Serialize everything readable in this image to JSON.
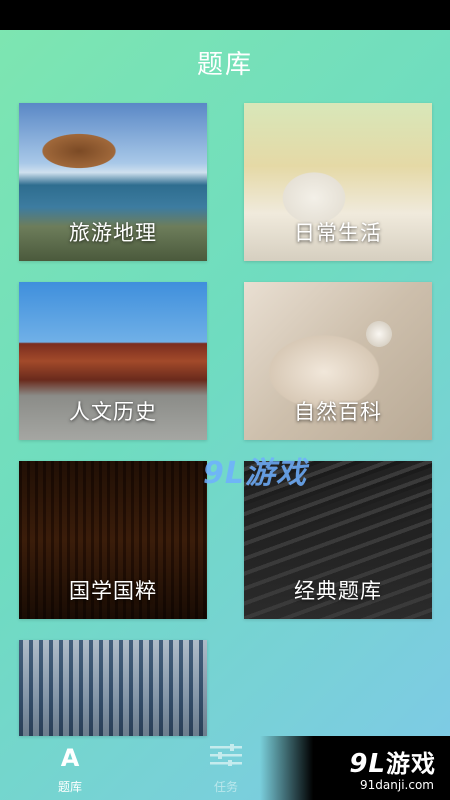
{
  "header": {
    "title": "题库"
  },
  "categories": [
    {
      "label": "旅游地理",
      "image": "travel-geography-photo"
    },
    {
      "label": "日常生活",
      "image": "daily-life-photo"
    },
    {
      "label": "人文历史",
      "image": "humanities-history-photo"
    },
    {
      "label": "自然百科",
      "image": "nature-encyclopedia-photo"
    },
    {
      "label": "国学国粹",
      "image": "chinese-classics-photo"
    },
    {
      "label": "经典题库",
      "image": "classic-questions-photo"
    },
    {
      "label": "",
      "image": "library-photo"
    }
  ],
  "tabbar": {
    "tabs": [
      {
        "label": "题库",
        "icon": "letter-a-icon",
        "glyph": "A",
        "active": true
      },
      {
        "label": "任务",
        "icon": "sliders-icon",
        "active": false
      }
    ]
  },
  "watermark": {
    "text": "9L游戏"
  },
  "brand": {
    "num": "9L",
    "name": "游戏",
    "url": "91danji.com"
  },
  "colors": {
    "bg_start": "#7ee6b0",
    "bg_end": "#7fc9e8",
    "text": "#ffffff"
  }
}
